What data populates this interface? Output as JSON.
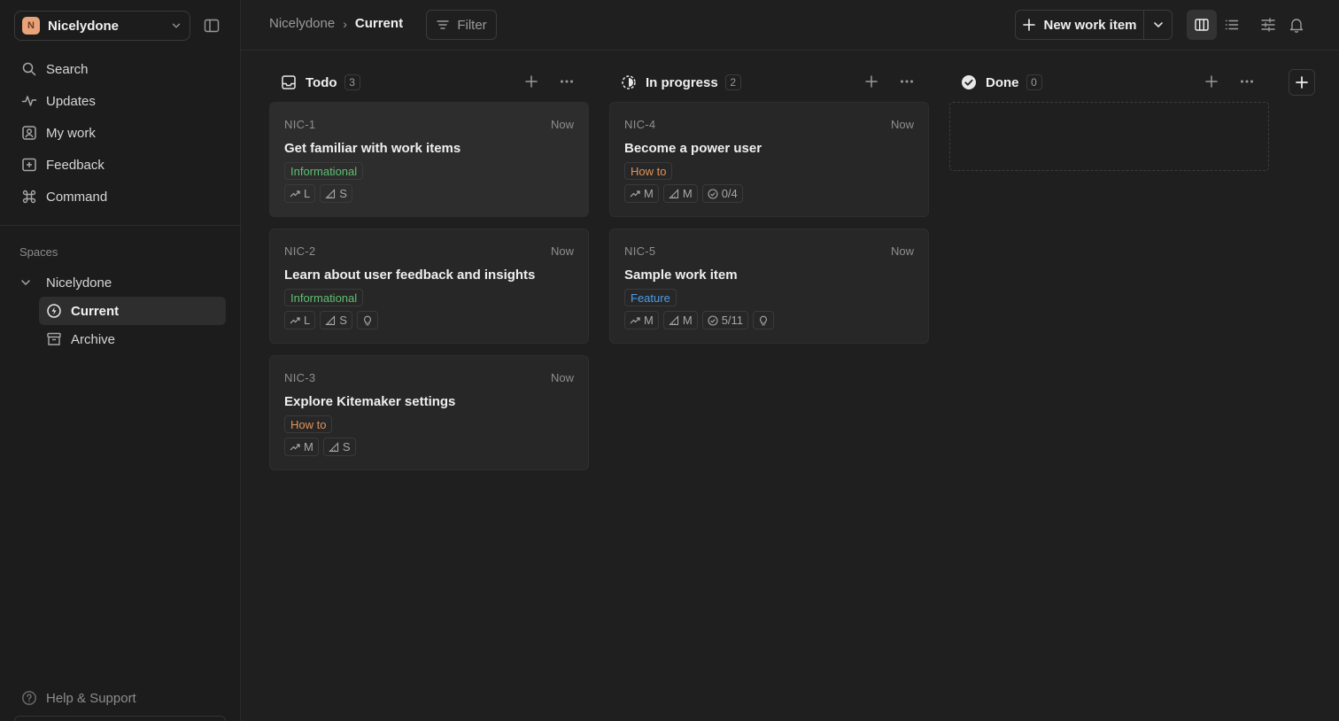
{
  "workspace": {
    "avatar_letter": "N",
    "name": "Nicelydone"
  },
  "nav": [
    {
      "label": "Search",
      "icon": "search-icon"
    },
    {
      "label": "Updates",
      "icon": "activity-icon"
    },
    {
      "label": "My work",
      "icon": "user-square-icon"
    },
    {
      "label": "Feedback",
      "icon": "feedback-icon"
    },
    {
      "label": "Command",
      "icon": "command-icon"
    }
  ],
  "spaces": {
    "label": "Spaces",
    "root": "Nicelydone",
    "children": [
      {
        "label": "Current",
        "active": true
      },
      {
        "label": "Archive",
        "active": false
      }
    ]
  },
  "help": "Help & Support",
  "breadcrumb": {
    "parent": "Nicelydone",
    "separator": "›",
    "current": "Current"
  },
  "toolbar": {
    "filter": "Filter",
    "new_item": "New work item"
  },
  "columns": [
    {
      "title": "Todo",
      "count": "3",
      "cards": [
        {
          "id": "NIC-1",
          "time": "Now",
          "title": "Get familiar with work items",
          "tag": "Informational",
          "tag_color": "#5fbf72",
          "priority": "L",
          "size": "S",
          "checks": "",
          "idea": false
        },
        {
          "id": "NIC-2",
          "time": "Now",
          "title": "Learn about user feedback and insights",
          "tag": "Informational",
          "tag_color": "#5fbf72",
          "priority": "L",
          "size": "S",
          "checks": "",
          "idea": true
        },
        {
          "id": "NIC-3",
          "time": "Now",
          "title": "Explore Kitemaker settings",
          "tag": "How to",
          "tag_color": "#e0935a",
          "priority": "M",
          "size": "S",
          "checks": "",
          "idea": false
        }
      ]
    },
    {
      "title": "In progress",
      "count": "2",
      "cards": [
        {
          "id": "NIC-4",
          "time": "Now",
          "title": "Become a power user",
          "tag": "How to",
          "tag_color": "#e0935a",
          "priority": "M",
          "size": "M",
          "checks": "0/4",
          "idea": false
        },
        {
          "id": "NIC-5",
          "time": "Now",
          "title": "Sample work item",
          "tag": "Feature",
          "tag_color": "#4c9de8",
          "priority": "M",
          "size": "M",
          "checks": "5/11",
          "idea": true
        }
      ]
    },
    {
      "title": "Done",
      "count": "0",
      "cards": []
    }
  ]
}
